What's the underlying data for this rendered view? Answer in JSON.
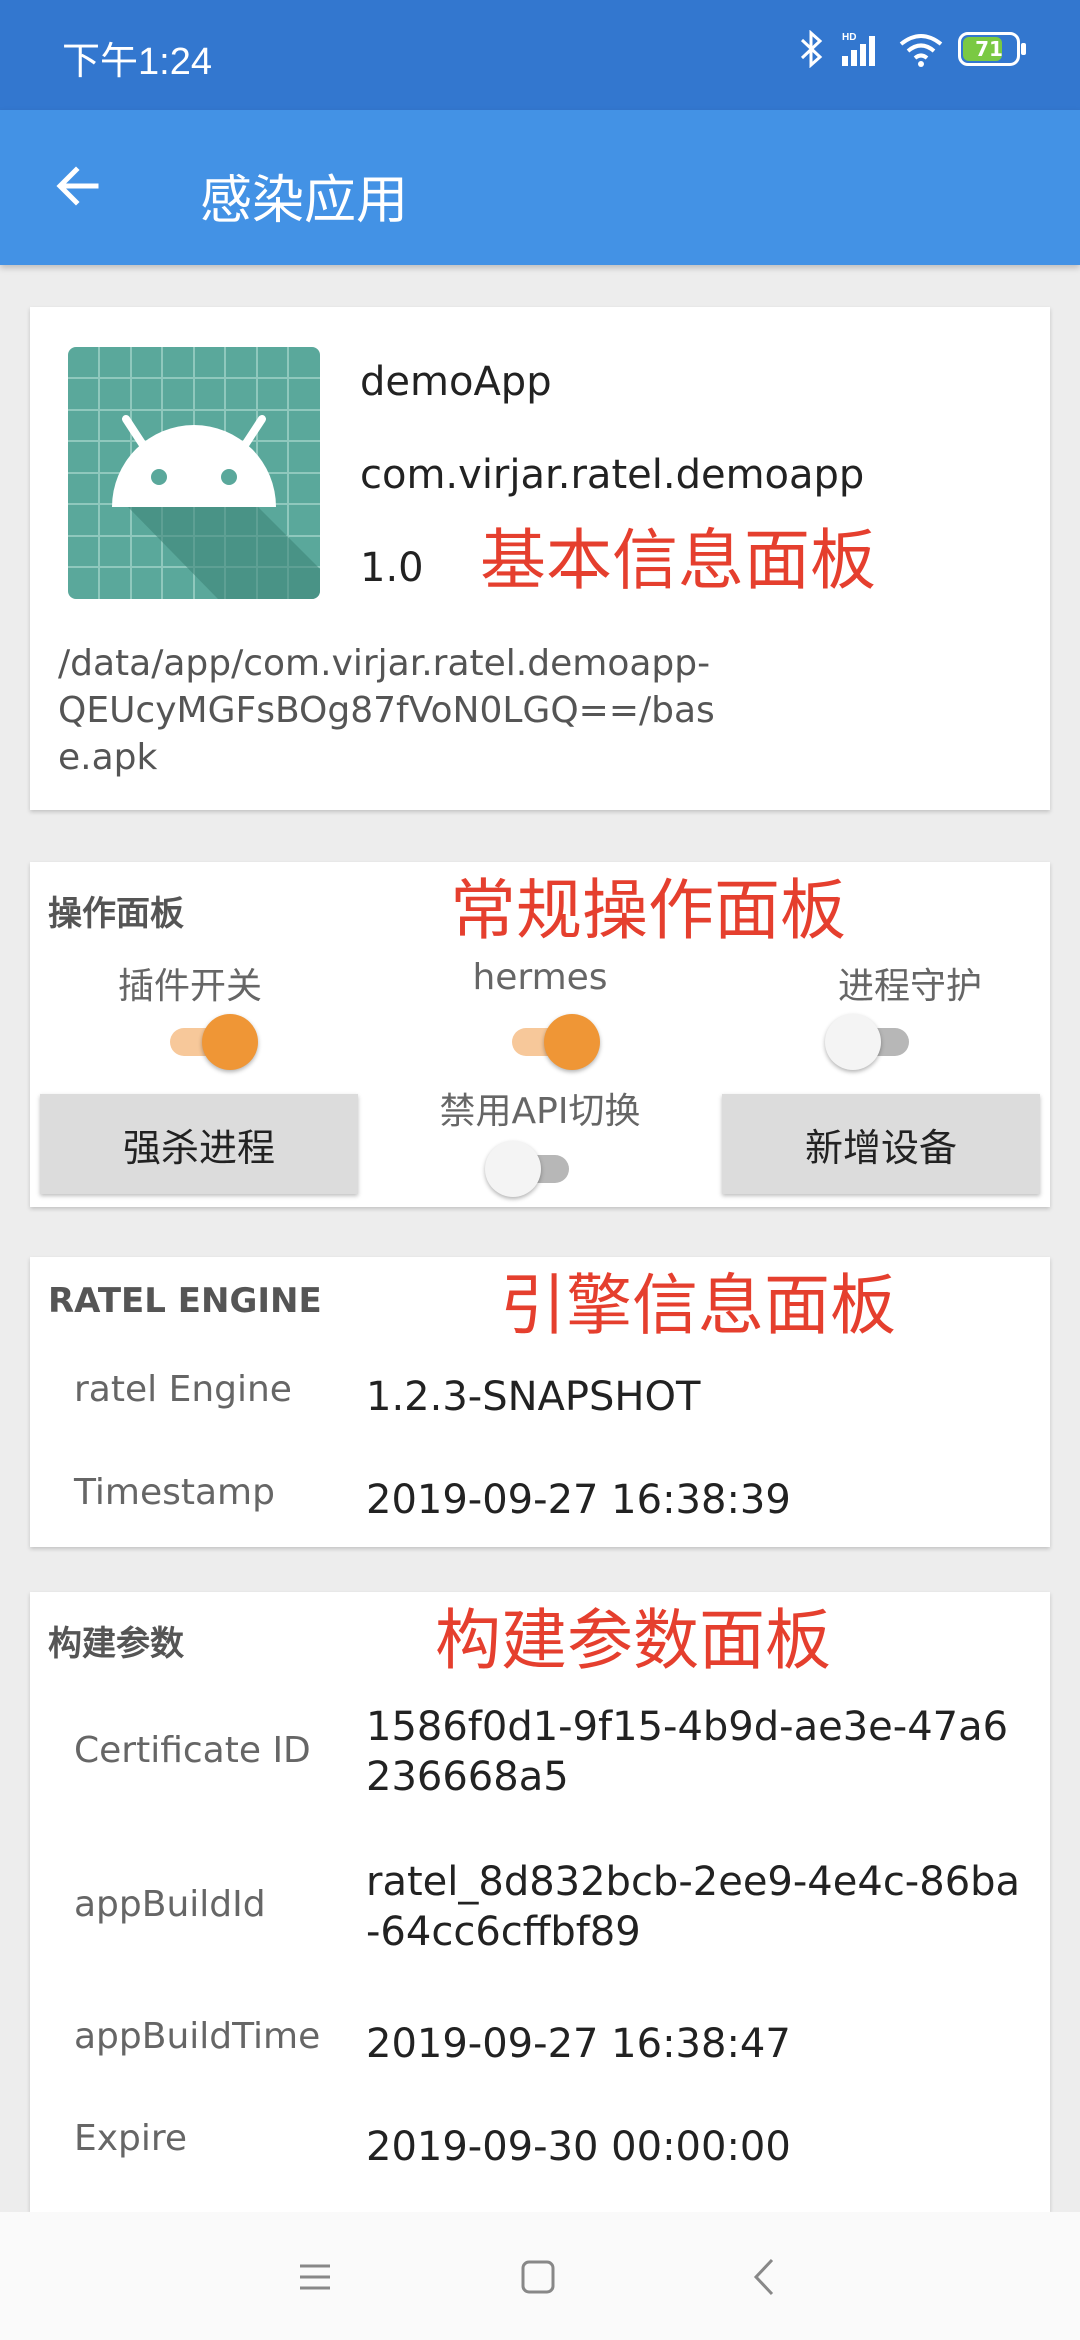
{
  "status_bar": {
    "time": "下午1:24",
    "battery": "71"
  },
  "app_bar": {
    "title": "感染应用"
  },
  "basic_info": {
    "app_name": "demoApp",
    "package": "com.virjar.ratel.demoapp",
    "version": "1.0",
    "apk_path": "/data/app/com.virjar.ratel.demoapp-QEUcyMGFsBOg87fVoN0LGQ==/base.apk",
    "annotation": "基本信息面板"
  },
  "operations": {
    "header": "操作面板",
    "annotation": "常规操作面板",
    "plugin_switch": {
      "label": "插件开关",
      "on": true
    },
    "hermes": {
      "label": "hermes",
      "on": true
    },
    "guard": {
      "label": "进程守护",
      "on": false
    },
    "disable_api": {
      "label": "禁用API切换",
      "on": false
    },
    "kill_button": "强杀进程",
    "add_device_button": "新增设备"
  },
  "engine": {
    "header": "RATEL ENGINE",
    "annotation": "引擎信息面板",
    "rows": [
      {
        "key": "ratel Engine",
        "value": "1.2.3-SNAPSHOT"
      },
      {
        "key": "Timestamp",
        "value": "2019-09-27 16:38:39"
      }
    ]
  },
  "build": {
    "header": "构建参数",
    "annotation": "构建参数面板",
    "rows": [
      {
        "key": "Certificate ID",
        "value": "1586f0d1-9f15-4b9d-ae3e-47a6236668a5"
      },
      {
        "key": "appBuildId",
        "value": "ratel_8d832bcb-2ee9-4e4c-86ba-64cc6cffbf89"
      },
      {
        "key": "appBuildTime",
        "value": "2019-09-27 16:38:47"
      },
      {
        "key": "Expire",
        "value": "2019-09-30 00:00:00"
      }
    ]
  },
  "icons": {
    "back": "arrow-left-icon",
    "bluetooth": "bluetooth-icon",
    "signal": "signal-icon",
    "wifi": "wifi-icon",
    "app": "android-app-icon",
    "menu": "menu-icon",
    "home": "home-icon",
    "nav_back": "nav-back-icon"
  },
  "colors": {
    "status_bar": "#3377cf",
    "app_bar": "#4392e5",
    "annotation": "#e53f2e",
    "switch_on": "#ef9636"
  }
}
